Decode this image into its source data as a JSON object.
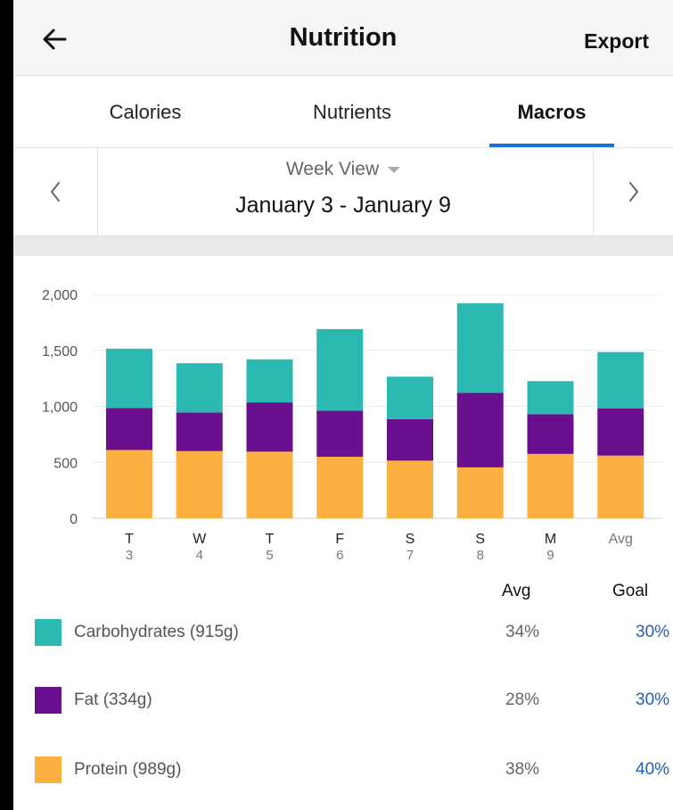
{
  "header": {
    "title": "Nutrition",
    "export_label": "Export",
    "back_icon": "arrow-left-icon"
  },
  "tabs": [
    {
      "label": "Calories",
      "active": false
    },
    {
      "label": "Nutrients",
      "active": false
    },
    {
      "label": "Macros",
      "active": true
    }
  ],
  "week_nav": {
    "view_label": "Week View",
    "date_range": "January 3 - January 9",
    "prev_icon": "chevron-left-icon",
    "next_icon": "chevron-right-icon"
  },
  "colors": {
    "carbs": "#2bb9b1",
    "fat": "#6a0f8e",
    "protein": "#fbb040",
    "accent": "#1e6fd9",
    "goal": "#1e5fb8"
  },
  "chart_data": {
    "type": "bar",
    "stacked": true,
    "categories": [
      "T",
      "W",
      "T",
      "F",
      "S",
      "S",
      "M",
      "Avg"
    ],
    "sublabels": [
      "3",
      "4",
      "5",
      "6",
      "7",
      "8",
      "9",
      ""
    ],
    "series": [
      {
        "name": "Protein",
        "values": [
          610,
          600,
          595,
          550,
          515,
          455,
          575,
          560
        ]
      },
      {
        "name": "Fat",
        "values": [
          375,
          345,
          440,
          410,
          370,
          665,
          355,
          420
        ]
      },
      {
        "name": "Carbohydrates",
        "values": [
          530,
          440,
          385,
          730,
          380,
          800,
          295,
          505
        ]
      }
    ],
    "ylim": [
      0,
      2000
    ],
    "yticks": [
      "0",
      "500",
      "1,000",
      "1,500",
      "2,000"
    ],
    "grid": true
  },
  "legend": {
    "avg_header": "Avg",
    "goal_header": "Goal",
    "items": [
      {
        "label": "Carbohydrates (915g)",
        "avg": "34%",
        "goal": "30%"
      },
      {
        "label": "Fat (334g)",
        "avg": "28%",
        "goal": "30%"
      },
      {
        "label": "Protein (989g)",
        "avg": "38%",
        "goal": "40%"
      }
    ]
  }
}
